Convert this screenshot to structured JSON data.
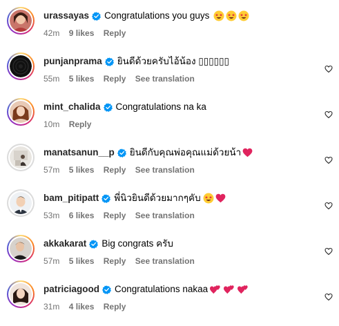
{
  "colors": {
    "text": "#000000",
    "meta": "#737373",
    "verified": "#0095f6",
    "heart": "#ed4956"
  },
  "comments": [
    {
      "username": "urassayas",
      "text": "Congratulations you guys",
      "emojis": [
        "star-struck-emoji",
        "star-struck-emoji",
        "star-struck-emoji"
      ],
      "time": "42m",
      "likes": "9 likes",
      "reply": "Reply",
      "translate": ""
    },
    {
      "username": "punjanprama",
      "text": "ยินดีด้วยครับไอ้น้อง ▯▯▯▯▯▯",
      "emojis": [],
      "time": "55m",
      "likes": "5 likes",
      "reply": "Reply",
      "translate": "See translation"
    },
    {
      "username": "mint_chalida",
      "text": "Congratulations na ka",
      "emojis": [],
      "time": "10m",
      "likes": "",
      "reply": "Reply",
      "translate": ""
    },
    {
      "username": "manatsanun__p",
      "text": "ยินดีกับคุณพ่อคุณแม่ด้วยน้า",
      "emojis": [
        "red-heart-emoji"
      ],
      "time": "57m",
      "likes": "5 likes",
      "reply": "Reply",
      "translate": "See translation"
    },
    {
      "username": "bam_pitipatt",
      "text": "พี่นิวยินดีด้วยมากๆคับ",
      "emojis": [
        "star-struck-emoji",
        "red-heart-emoji"
      ],
      "time": "53m",
      "likes": "6 likes",
      "reply": "Reply",
      "translate": "See translation"
    },
    {
      "username": "akkakarat",
      "text": "Big congrats ครับ",
      "emojis": [],
      "time": "57m",
      "likes": "5 likes",
      "reply": "Reply",
      "translate": "See translation"
    },
    {
      "username": "patriciagood",
      "text": "Congratulations nakaa",
      "emojis": [
        "two-hearts-emoji",
        "two-hearts-emoji",
        "two-hearts-emoji"
      ],
      "time": "31m",
      "likes": "4 likes",
      "reply": "Reply",
      "translate": ""
    }
  ]
}
